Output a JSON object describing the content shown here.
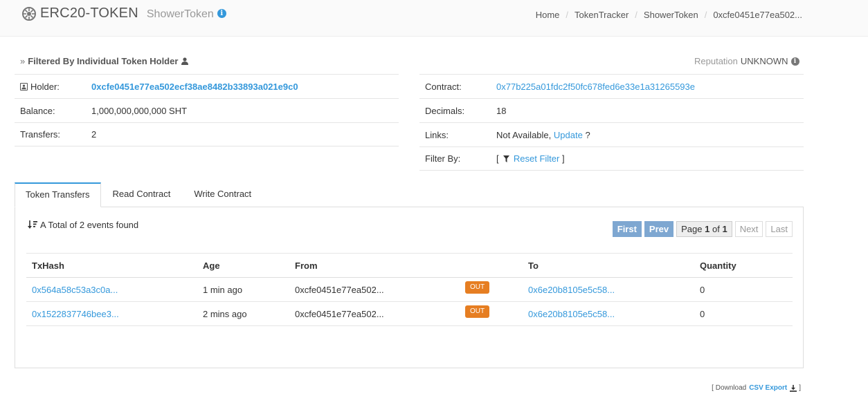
{
  "header": {
    "title": "ERC20-TOKEN",
    "subtitle": "ShowerToken",
    "breadcrumb": [
      "Home",
      "TokenTracker",
      "ShowerToken",
      "0xcfe0451e77ea502..."
    ]
  },
  "filter": {
    "title": "Filtered By Individual Token Holder",
    "reputation_label": "Reputation",
    "reputation_value": "UNKNOWN"
  },
  "overview_left": [
    {
      "label": "Holder:",
      "value": "0xcfe0451e77ea502ecf38ae8482b33893a021e9c0"
    },
    {
      "label": "Balance:",
      "value": "1,000,000,000,000 SHT"
    },
    {
      "label": "Transfers:",
      "value": "2"
    }
  ],
  "overview_right": {
    "contract_label": "Contract:",
    "contract_value": "0x77b225a01fdc2f50fc678fed6e33e1a31265593e",
    "decimals_label": "Decimals:",
    "decimals_value": "18",
    "links_label": "Links:",
    "links_text": "Not Available,",
    "links_update": "Update",
    "links_q": "?",
    "filterby_label": "Filter By:",
    "filterby_open": "[",
    "filterby_link": "Reset Filter",
    "filterby_close": "]"
  },
  "tabs": [
    "Token Transfers",
    "Read Contract",
    "Write Contract"
  ],
  "events_text": "A Total of 2 events found",
  "pager": {
    "first": "First",
    "prev": "Prev",
    "page_prefix": "Page",
    "page_current": "1",
    "page_of": "of",
    "page_total": "1",
    "next": "Next",
    "last": "Last"
  },
  "table": {
    "headers": [
      "TxHash",
      "Age",
      "From",
      "",
      "To",
      "Quantity"
    ],
    "rows": [
      {
        "txhash": "0x564a58c53a3c0a...",
        "age": "1 min ago",
        "from": "0xcfe0451e77ea502...",
        "dir": "OUT",
        "to": "0x6e20b8105e5c58...",
        "qty": "0"
      },
      {
        "txhash": "0x1522837746bee3...",
        "age": "2 mins ago",
        "from": "0xcfe0451e77ea502...",
        "dir": "OUT",
        "to": "0x6e20b8105e5c58...",
        "qty": "0"
      }
    ]
  },
  "csv": {
    "open": "[ Download",
    "link": "CSV Export",
    "close": "]"
  },
  "colors": {
    "accent": "#3498db",
    "badge": "#e67e22",
    "pager_active": "#7ea7d1"
  }
}
